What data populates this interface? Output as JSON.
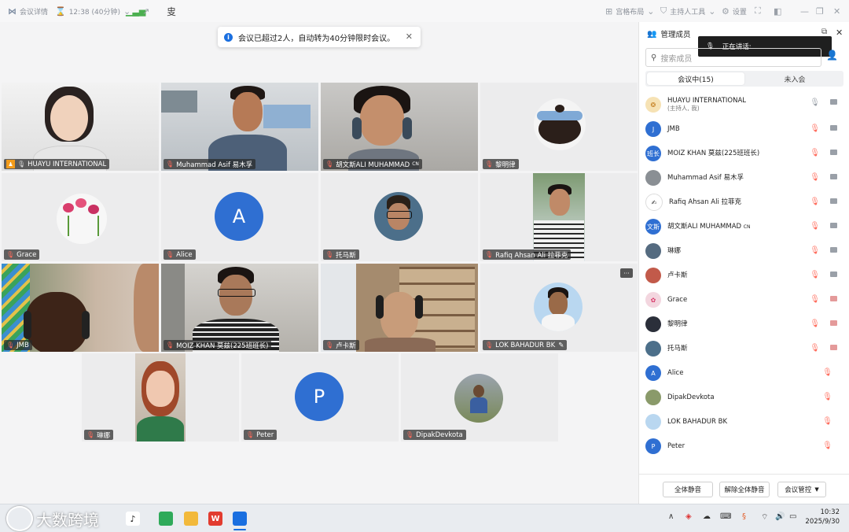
{
  "topbar": {
    "meeting_details": "会议详情",
    "timer": "12:38 (40分钟)",
    "layout": "宫格布局",
    "host_tools": "主持人工具",
    "settings": "设置"
  },
  "toast": {
    "text": "会议已超过2人，自动转为40分钟限时会议。"
  },
  "tiles": [
    {
      "name": "HUAYU INTERNATIONAL"
    },
    {
      "name": "Muhammad Asif 易木孚"
    },
    {
      "name": "胡文斯ALI MUHAMMAD",
      "suffix": "CN"
    },
    {
      "name": "黎明律"
    },
    {
      "name": "Grace"
    },
    {
      "name": "Alice",
      "avatar_letter": "A"
    },
    {
      "name": "托马斯"
    },
    {
      "name": "Rafiq Ahsan Ali 拉菲克"
    },
    {
      "name": "JMB"
    },
    {
      "name": "MOIZ KHAN 莫兹(225班班长)"
    },
    {
      "name": "卢卡斯"
    },
    {
      "name": "LOK  BAHADUR BK"
    },
    {
      "name": "琳娜"
    },
    {
      "name": "Peter",
      "avatar_letter": "P"
    },
    {
      "name": "DipakDevkota"
    }
  ],
  "tile_more": "···",
  "panel": {
    "title": "管理成员",
    "speaking": "正在讲话:",
    "search_placeholder": "搜索成员",
    "tab_in_meeting": "会议中(15)",
    "tab_not_joined": "未入会",
    "members": [
      {
        "name": "HUAYU INTERNATIONAL",
        "sub": "(主持人, 我)"
      },
      {
        "name": "JMB",
        "avatar": "J"
      },
      {
        "name": "MOIZ KHAN 莫兹(225班班长)",
        "avatar": "班长"
      },
      {
        "name": "Muhammad Asif 易木孚"
      },
      {
        "name": "Rafiq Ahsan Ali 拉菲克"
      },
      {
        "name": "胡文斯ALI MUHAMMAD",
        "suffix": "CN",
        "avatar": "文斯"
      },
      {
        "name": "琳娜"
      },
      {
        "name": "卢卡斯"
      },
      {
        "name": "Grace"
      },
      {
        "name": "黎明律"
      },
      {
        "name": "托马斯"
      },
      {
        "name": "Alice",
        "avatar": "A"
      },
      {
        "name": "DipakDevkota"
      },
      {
        "name": "LOK  BAHADUR BK"
      },
      {
        "name": "Peter",
        "avatar": "P"
      }
    ],
    "mute_all": "全体静音",
    "unmute_all": "解除全体静音",
    "meeting_control": "会议管控"
  },
  "taskbar": {
    "time": "10:32",
    "date": "2025/9/30"
  },
  "watermark": "大数跨境"
}
